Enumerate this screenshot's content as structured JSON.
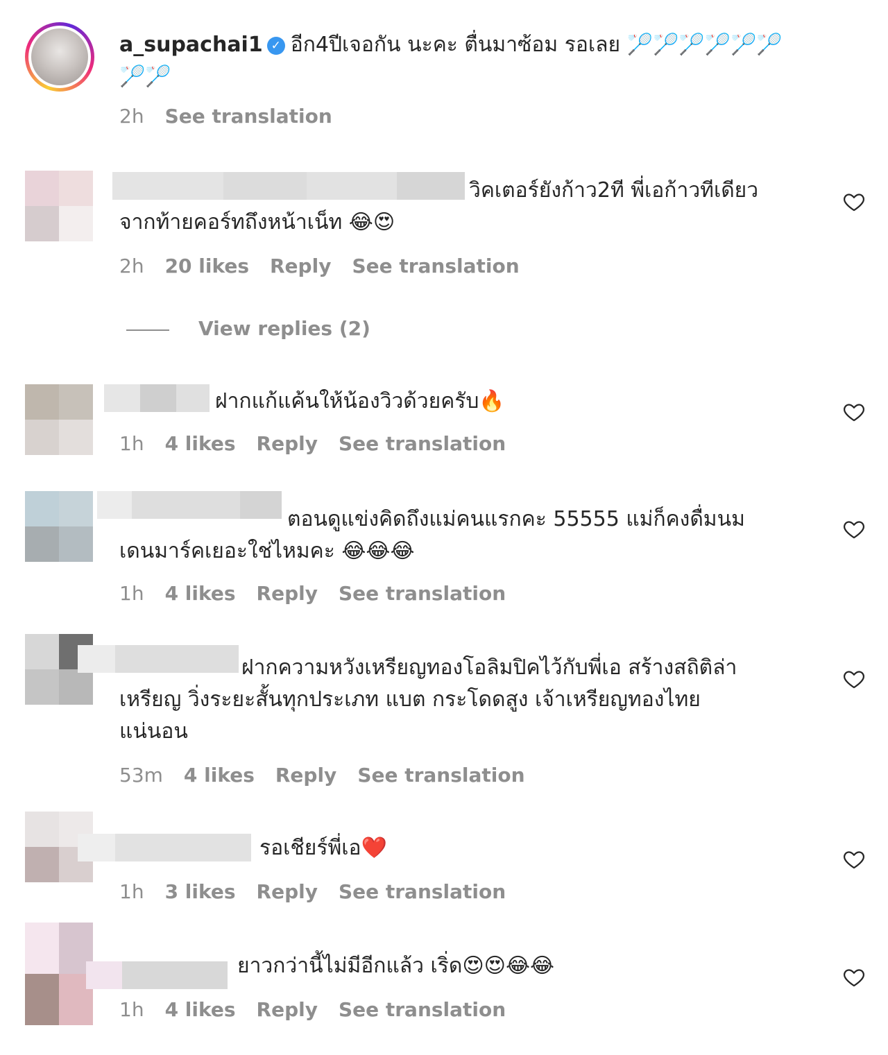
{
  "caption": {
    "username": "a_supachai1",
    "verified_icon": "verified-badge-icon",
    "text_line1": "อีก4ปีเจอกัน นะคะ ตื่นมาซ้อม รอเลย 🏸🏸🏸🏸🏸🏸",
    "text_line2": "🏸🏸",
    "time": "2h",
    "see_translation": "See translation"
  },
  "comments": [
    {
      "line1": "วิคเตอร์ยังก้าว2ที พี่เอก้าวทีเดียว",
      "line2": "จากท้ายคอร์ทถึงหน้าเน็ท 😂😍",
      "time": "2h",
      "likes": "20 likes",
      "reply": "Reply",
      "see_translation": "See translation",
      "view_replies": "View replies (2)"
    },
    {
      "line1": "ฝากแก้แค้นให้น้องวิวด้วยครับ🔥",
      "time": "1h",
      "likes": "4 likes",
      "reply": "Reply",
      "see_translation": "See translation"
    },
    {
      "line1": "ตอนดูแข่งคิดถึงแม่คนแรกคะ 55555 แม่ก็คงดื่มนม",
      "line2": "เดนมาร์คเยอะใช่ไหมคะ 😂😂😂",
      "time": "1h",
      "likes": "4 likes",
      "reply": "Reply",
      "see_translation": "See translation"
    },
    {
      "line1": "ฝากความหวังเหรียญทองโอลิมปิคไว้กับพี่เอ สร้างสถิติล่า",
      "line2": "เหรียญ วิ่งระยะสั้นทุกประเภท แบต กระโดดสูง เจ้าเหรียญทองไทย",
      "line3": "แน่นอน",
      "time": "53m",
      "likes": "4 likes",
      "reply": "Reply",
      "see_translation": "See translation"
    },
    {
      "line1": "รอเชียร์พี่เอ❤️",
      "time": "1h",
      "likes": "3 likes",
      "reply": "Reply",
      "see_translation": "See translation"
    },
    {
      "line1": "ยาวกว่านี้ไม่มีอีกแล้ว เริ่ด😍😍😂😂",
      "time": "1h",
      "likes": "4 likes",
      "reply": "Reply",
      "see_translation": "See translation"
    }
  ],
  "icons": {
    "like": "heart-outline-icon"
  }
}
